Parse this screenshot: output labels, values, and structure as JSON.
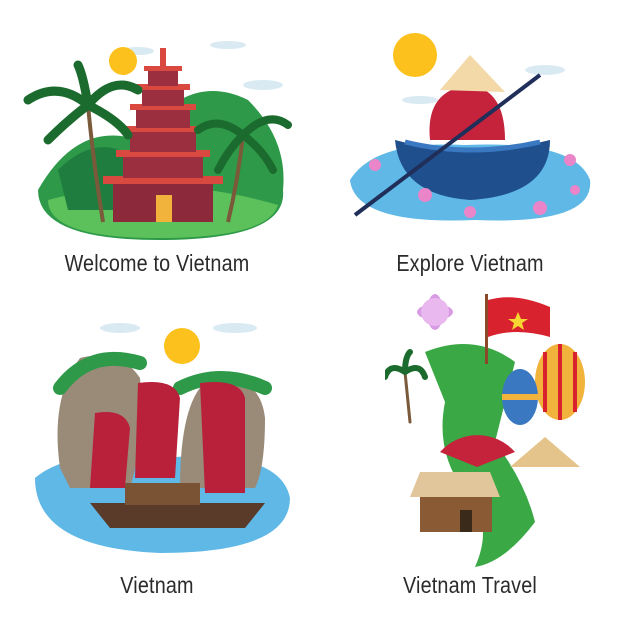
{
  "panels": [
    {
      "caption": "Welcome to Vietnam"
    },
    {
      "caption": "Explore Vietnam"
    },
    {
      "caption": "Vietnam"
    },
    {
      "caption": "Vietnam Travel"
    }
  ],
  "colors": {
    "caption_text": "#2b2b2b",
    "sun": "#fcc11c",
    "water": "#5fb8e6",
    "greenery": "#39a845",
    "red_accent": "#c4233b",
    "flag_star": "#f6d630"
  }
}
